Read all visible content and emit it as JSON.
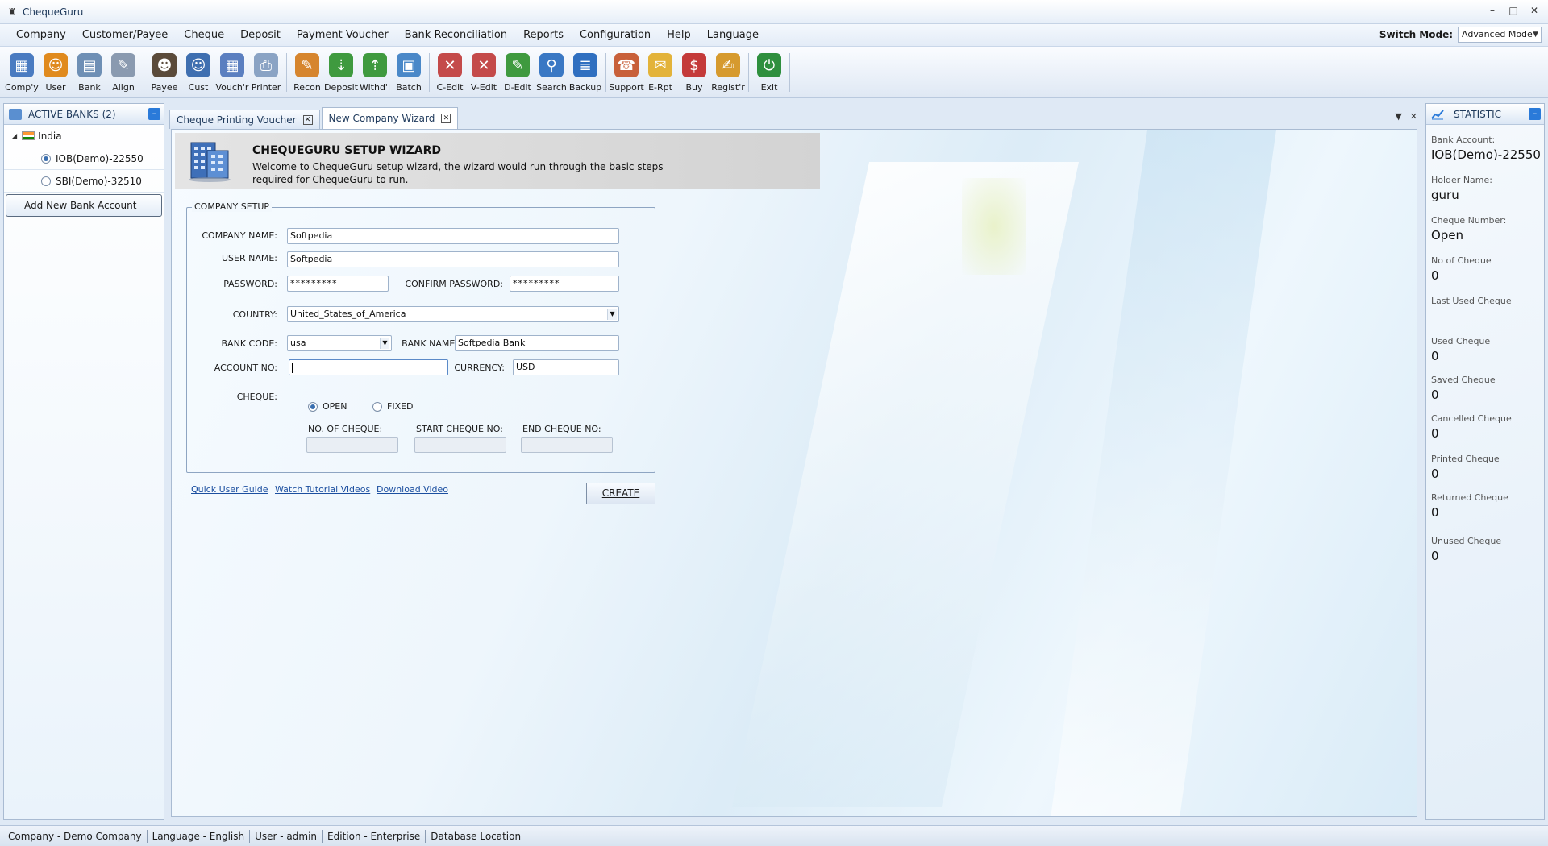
{
  "window": {
    "title": "ChequeGuru"
  },
  "menu": [
    "Company",
    "Customer/Payee",
    "Cheque",
    "Deposit",
    "Payment Voucher",
    "Bank Reconciliation",
    "Reports",
    "Configuration",
    "Help",
    "Language"
  ],
  "switch_mode": {
    "label": "Switch Mode:",
    "value": "Advanced Mode"
  },
  "toolbar": {
    "groups": [
      [
        {
          "label": "Comp'y",
          "icon": "company-icon",
          "color": "#4a7bc1"
        },
        {
          "label": "User",
          "icon": "user-icon",
          "color": "#e08a1e"
        },
        {
          "label": "Bank",
          "icon": "bank-icon",
          "color": "#6e8fb5"
        },
        {
          "label": "Align",
          "icon": "align-icon",
          "color": "#8a9ab0"
        }
      ],
      [
        {
          "label": "Payee",
          "icon": "payee-icon",
          "color": "#5a4a3a"
        },
        {
          "label": "Cust",
          "icon": "customer-icon",
          "color": "#3f6fb0"
        },
        {
          "label": "Vouch'r",
          "icon": "voucher-icon",
          "color": "#5b7fc0"
        },
        {
          "label": "Printer",
          "icon": "printer-icon",
          "color": "#8aa3c4"
        }
      ],
      [
        {
          "label": "Recon",
          "icon": "recon-icon",
          "color": "#d6852e"
        },
        {
          "label": "Deposit",
          "icon": "deposit-icon",
          "color": "#3f9a3f"
        },
        {
          "label": "Withd'l",
          "icon": "withdrawal-icon",
          "color": "#3f9a3f"
        },
        {
          "label": "Batch",
          "icon": "batch-icon",
          "color": "#4a88c8"
        }
      ],
      [
        {
          "label": "C-Edit",
          "icon": "cheque-edit-icon",
          "color": "#c44a4a"
        },
        {
          "label": "V-Edit",
          "icon": "voucher-edit-icon",
          "color": "#c44a4a"
        },
        {
          "label": "D-Edit",
          "icon": "deposit-edit-icon",
          "color": "#3f9a3f"
        },
        {
          "label": "Search",
          "icon": "search-icon",
          "color": "#3a78c4"
        },
        {
          "label": "Backup",
          "icon": "backup-icon",
          "color": "#2f6fc0"
        }
      ],
      [
        {
          "label": "Support",
          "icon": "support-icon",
          "color": "#c8603a"
        },
        {
          "label": "E-Rpt",
          "icon": "email-report-icon",
          "color": "#e3b33a"
        },
        {
          "label": "Buy",
          "icon": "buy-icon",
          "color": "#c43a3a"
        },
        {
          "label": "Regist'r",
          "icon": "register-icon",
          "color": "#d69a2e"
        }
      ],
      [
        {
          "label": "Exit",
          "icon": "exit-icon",
          "color": "#2e8f3e"
        }
      ]
    ]
  },
  "left_panel": {
    "title": "ACTIVE BANKS (2)",
    "country": "India",
    "banks": [
      {
        "name": "IOB(Demo)-22550",
        "selected": true
      },
      {
        "name": "SBI(Demo)-32510",
        "selected": false
      }
    ],
    "add_button": "Add New Bank Account"
  },
  "tabs": [
    {
      "label": "Cheque Printing Voucher",
      "active": false
    },
    {
      "label": "New Company Wizard",
      "active": true
    }
  ],
  "wizard": {
    "title": "CHEQUEGURU SETUP WIZARD",
    "description": "Welcome to ChequeGuru setup wizard, the wizard would run through the basic steps required for ChequeGuru to run."
  },
  "form": {
    "legend": "COMPANY SETUP",
    "company_name_label": "COMPANY NAME:",
    "company_name": "Softpedia",
    "user_name_label": "USER NAME:",
    "user_name": "Softpedia",
    "password_label": "PASSWORD:",
    "password": "*********",
    "confirm_password_label": "CONFIRM PASSWORD:",
    "confirm_password": "*********",
    "country_label": "COUNTRY:",
    "country": "United_States_of_America",
    "bank_code_label": "BANK CODE:",
    "bank_code": "usa",
    "bank_name_label": "BANK NAME:",
    "bank_name": "Softpedia Bank",
    "account_no_label": "ACCOUNT NO:",
    "account_no": "",
    "currency_label": "CURRENCY:",
    "currency": "USD",
    "cheque_label": "CHEQUE:",
    "cheque_open": "OPEN",
    "cheque_fixed": "FIXED",
    "cheque_selected": "OPEN",
    "no_of_cheque_label": "NO. OF CHEQUE:",
    "start_cheque_label": "START CHEQUE NO:",
    "end_cheque_label": "END CHEQUE NO:"
  },
  "links": {
    "quick_guide": "Quick User Guide",
    "tutorial": "Watch Tutorial Videos",
    "download": "Download Video"
  },
  "create_button": "CREATE",
  "statistics": {
    "title": "STATISTIC",
    "items": [
      {
        "label": "Bank Account:",
        "value": "IOB(Demo)-22550"
      },
      {
        "label": "Holder Name:",
        "value": "guru"
      },
      {
        "label": "Cheque Number:",
        "value": "Open"
      },
      {
        "label": "No of Cheque",
        "value": "0"
      },
      {
        "label": "Last Used Cheque",
        "value": ""
      },
      {
        "label": "Used Cheque",
        "value": "0"
      },
      {
        "label": "Saved Cheque",
        "value": "0"
      },
      {
        "label": "Cancelled Cheque",
        "value": "0"
      },
      {
        "label": "Printed Cheque",
        "value": "0"
      },
      {
        "label": "Returned Cheque",
        "value": "0"
      },
      {
        "label": "Unused Cheque",
        "value": "0"
      }
    ]
  },
  "status_bar": [
    "Company - Demo Company",
    "Language - English",
    "User - admin",
    "Edition - Enterprise",
    "Database Location"
  ]
}
